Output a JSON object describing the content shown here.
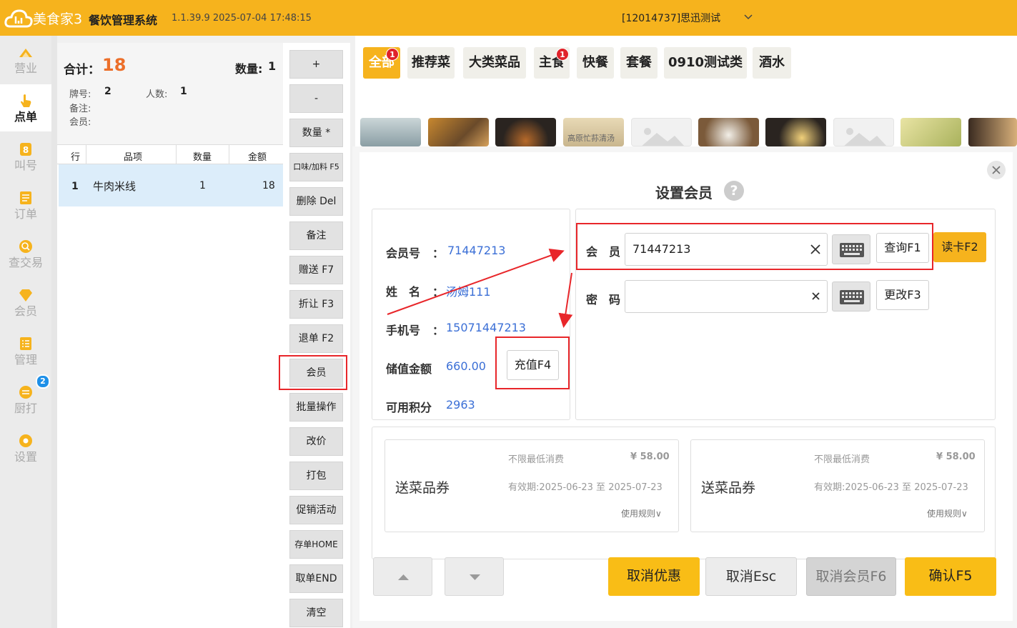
{
  "topbar": {
    "logo_text": "美食家3",
    "app_name": "餐饮管理系统",
    "version": "1.1.39.9 2025-07-04 17:48:15",
    "store": "[12014737]思迅测试"
  },
  "sidebar": {
    "items": [
      {
        "label": "营业"
      },
      {
        "label": "点单"
      },
      {
        "label": "叫号"
      },
      {
        "label": "订单"
      },
      {
        "label": "查交易"
      },
      {
        "label": "会员"
      },
      {
        "label": "管理"
      },
      {
        "label": "厨打",
        "badge": "2"
      },
      {
        "label": "设置"
      }
    ]
  },
  "order": {
    "total_label": "合计：",
    "total_value": "18",
    "qty_label": "数量:",
    "qty_value": "1",
    "table_label": "牌号:",
    "table_value": "2",
    "people_label": "人数:",
    "people_value": "1",
    "note_label": "备注:",
    "member_label": "会员:",
    "columns": [
      "行",
      "品项",
      "数量",
      "金额"
    ],
    "rows": [
      {
        "line": "1",
        "item": "牛肉米线",
        "qty": "1",
        "amount": "18"
      }
    ]
  },
  "actions": [
    "+",
    "-",
    "数量 *",
    "口味/加料 F5",
    "删除 Del",
    "备注",
    "赠送 F7",
    "折让 F3",
    "退单 F2",
    "会员",
    "批量操作",
    "改价",
    "打包",
    "促销活动",
    "存单HOME",
    "取单END",
    "清空"
  ],
  "categories": [
    {
      "label": "全部",
      "badge": "1"
    },
    {
      "label": "推荐菜"
    },
    {
      "label": "大类菜品"
    },
    {
      "label": "主食",
      "badge": "1"
    },
    {
      "label": "快餐"
    },
    {
      "label": "套餐"
    },
    {
      "label": "0910测试类"
    },
    {
      "label": "酒水"
    }
  ],
  "thumb_caption": "高原忙荪清汤",
  "modal": {
    "title": "设置会员",
    "help": "?",
    "info": {
      "card_no_label": "会员号",
      "card_no": "71447213",
      "name_label": "姓　名",
      "name": "汤姆111",
      "phone_label": "手机号",
      "phone": "15071447213",
      "balance_label": "储值金额",
      "balance": "660.00",
      "points_label": "可用积分",
      "points": "2963",
      "colon": "：",
      "recharge_button": "充值F4"
    },
    "member_label": "会　员",
    "member_value": "71447213",
    "password_label": "密　码",
    "query_button": "查询F1",
    "readcard_button": "读卡F2",
    "change_button": "更改F3",
    "coupons": [
      {
        "title": "送菜品券",
        "min": "不限最低消费",
        "price": "¥ 58.00",
        "validity": "有效期:2025-06-23 至 2025-07-23",
        "rule": "使用规则∨"
      },
      {
        "title": "送菜品券",
        "min": "不限最低消费",
        "price": "¥ 58.00",
        "validity": "有效期:2025-06-23 至 2025-07-23",
        "rule": "使用规则∨"
      }
    ],
    "cancel_discount": "取消优惠",
    "cancel_esc": "取消Esc",
    "cancel_member": "取消会员F6",
    "confirm": "确认F5"
  },
  "colors": {
    "accent": "#f6b31d",
    "link": "#3b6fd6",
    "highlight": "#e8262a",
    "badge_red": "#e0232a",
    "badge_blue": "#1e90e8"
  }
}
